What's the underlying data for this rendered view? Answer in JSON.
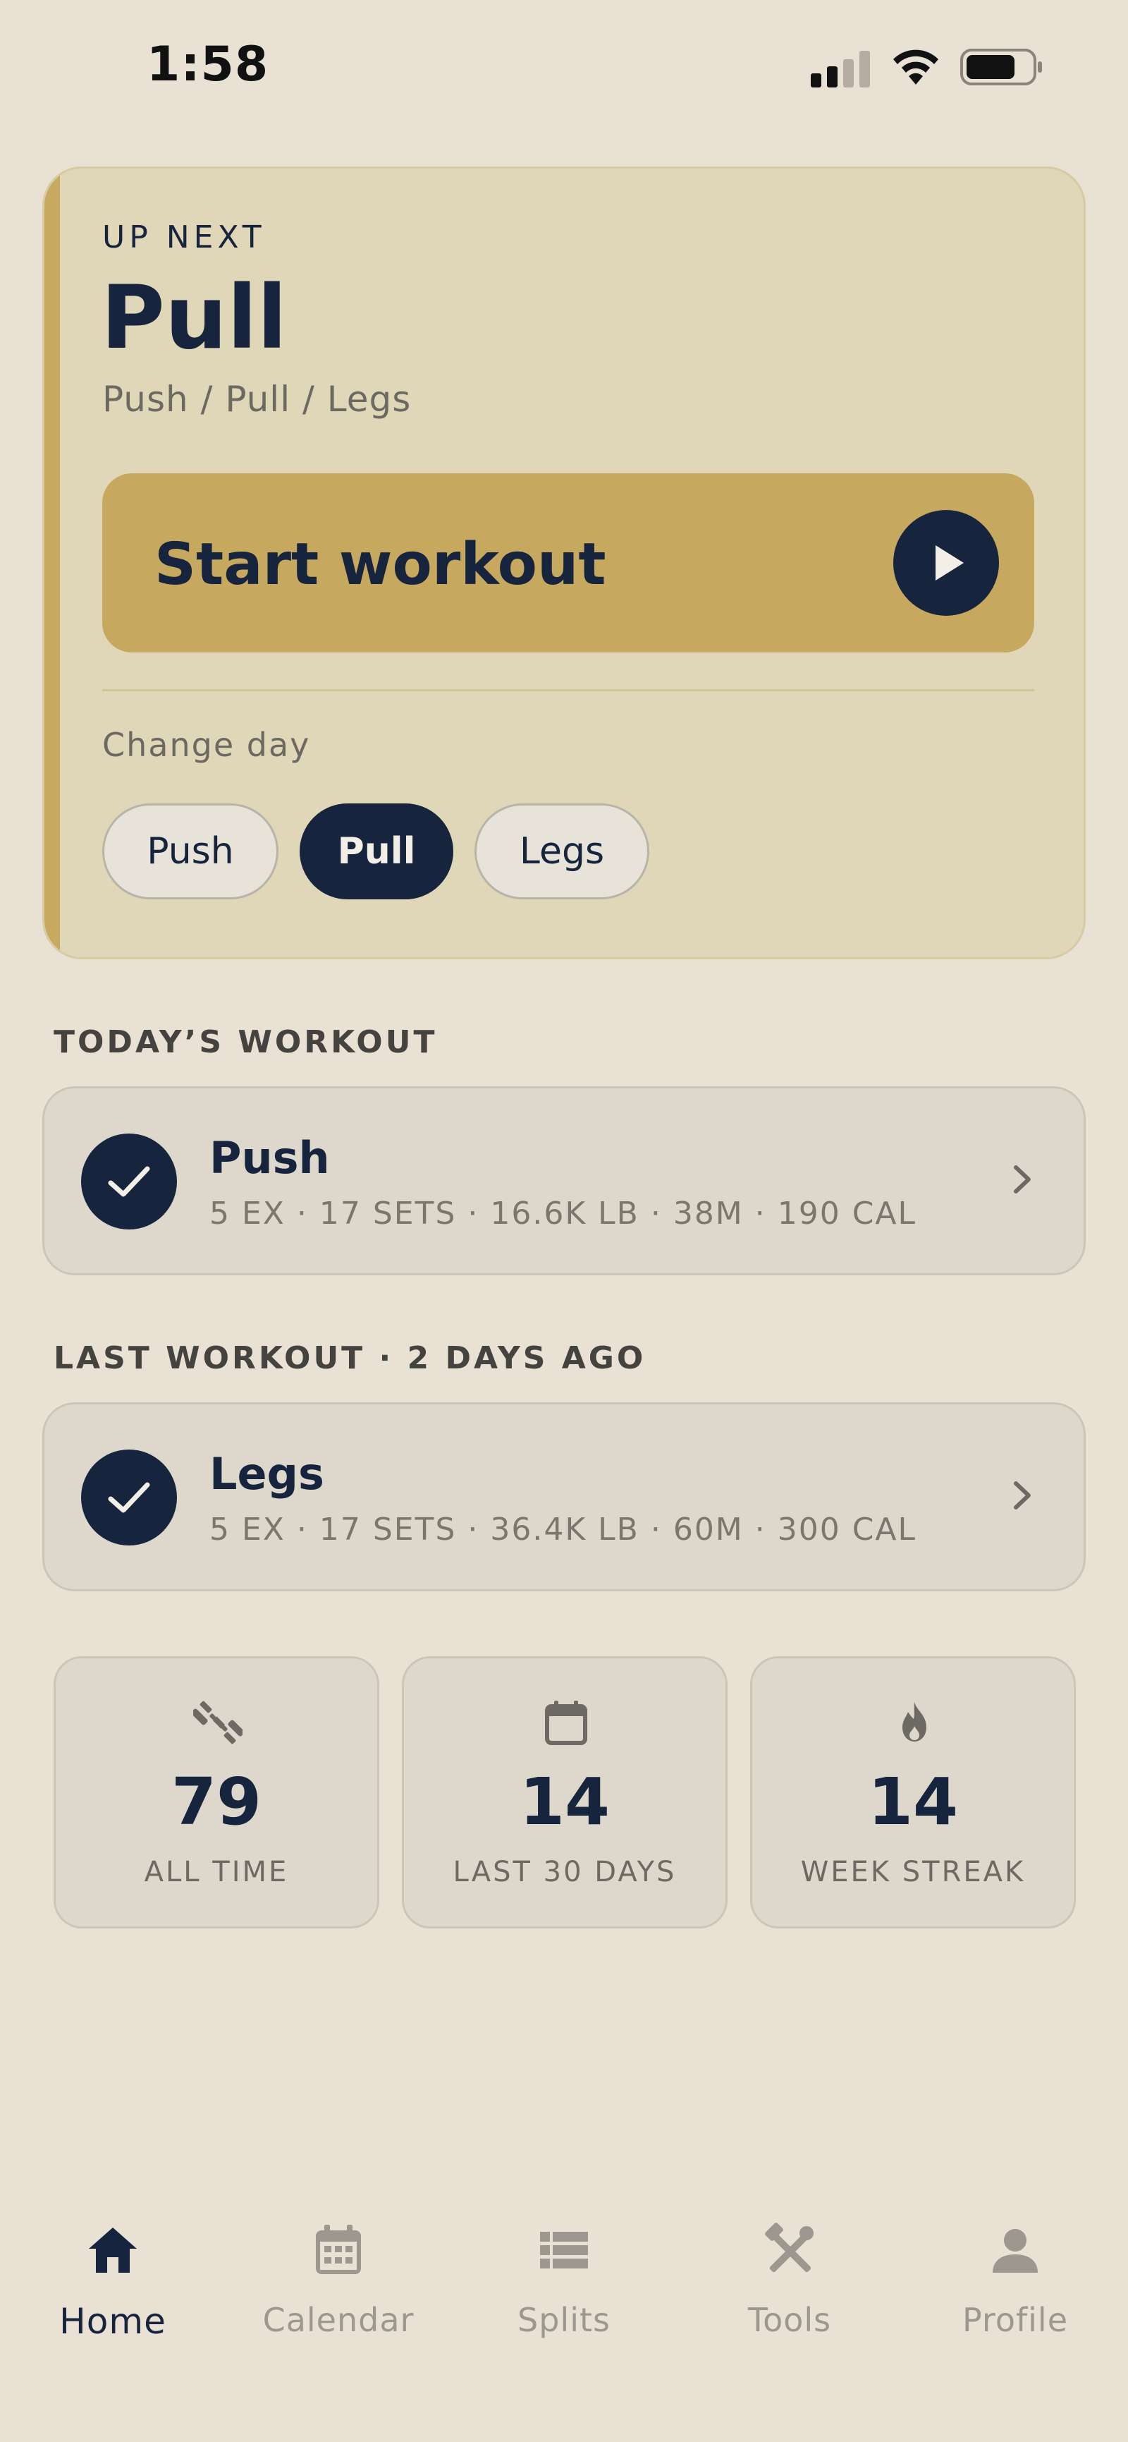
{
  "status_bar": {
    "time": "1:58"
  },
  "up_next": {
    "eyebrow": "UP NEXT",
    "title": "Pull",
    "split": "Push / Pull / Legs",
    "start_label": "Start workout",
    "change_day_label": "Change day",
    "days": [
      "Push",
      "Pull",
      "Legs"
    ],
    "selected_day": "Pull"
  },
  "todays_workout": {
    "header": "TODAY’S WORKOUT",
    "title": "Push",
    "meta": "5 EX · 17 SETS · 16.6K LB · 38M · 190 CAL"
  },
  "last_workout": {
    "header": "LAST WORKOUT · 2 DAYS AGO",
    "title": "Legs",
    "meta": "5 EX · 17 SETS · 36.4K LB · 60M · 300 CAL"
  },
  "stats": [
    {
      "icon": "dumbbell-icon",
      "value": "79",
      "label": "ALL TIME"
    },
    {
      "icon": "calendar-icon",
      "value": "14",
      "label": "LAST 30 DAYS"
    },
    {
      "icon": "flame-icon",
      "value": "14",
      "label": "WEEK STREAK"
    }
  ],
  "tabs": [
    {
      "icon": "home-icon",
      "label": "Home",
      "active": true
    },
    {
      "icon": "calendar-icon",
      "label": "Calendar",
      "active": false
    },
    {
      "icon": "list-icon",
      "label": "Splits",
      "active": false
    },
    {
      "icon": "tools-icon",
      "label": "Tools",
      "active": false
    },
    {
      "icon": "person-icon",
      "label": "Profile",
      "active": false
    }
  ],
  "colors": {
    "background": "#e9e1d4",
    "navy": "#16243d",
    "gold": "#c6a85e",
    "card": "#e0d6b8"
  }
}
